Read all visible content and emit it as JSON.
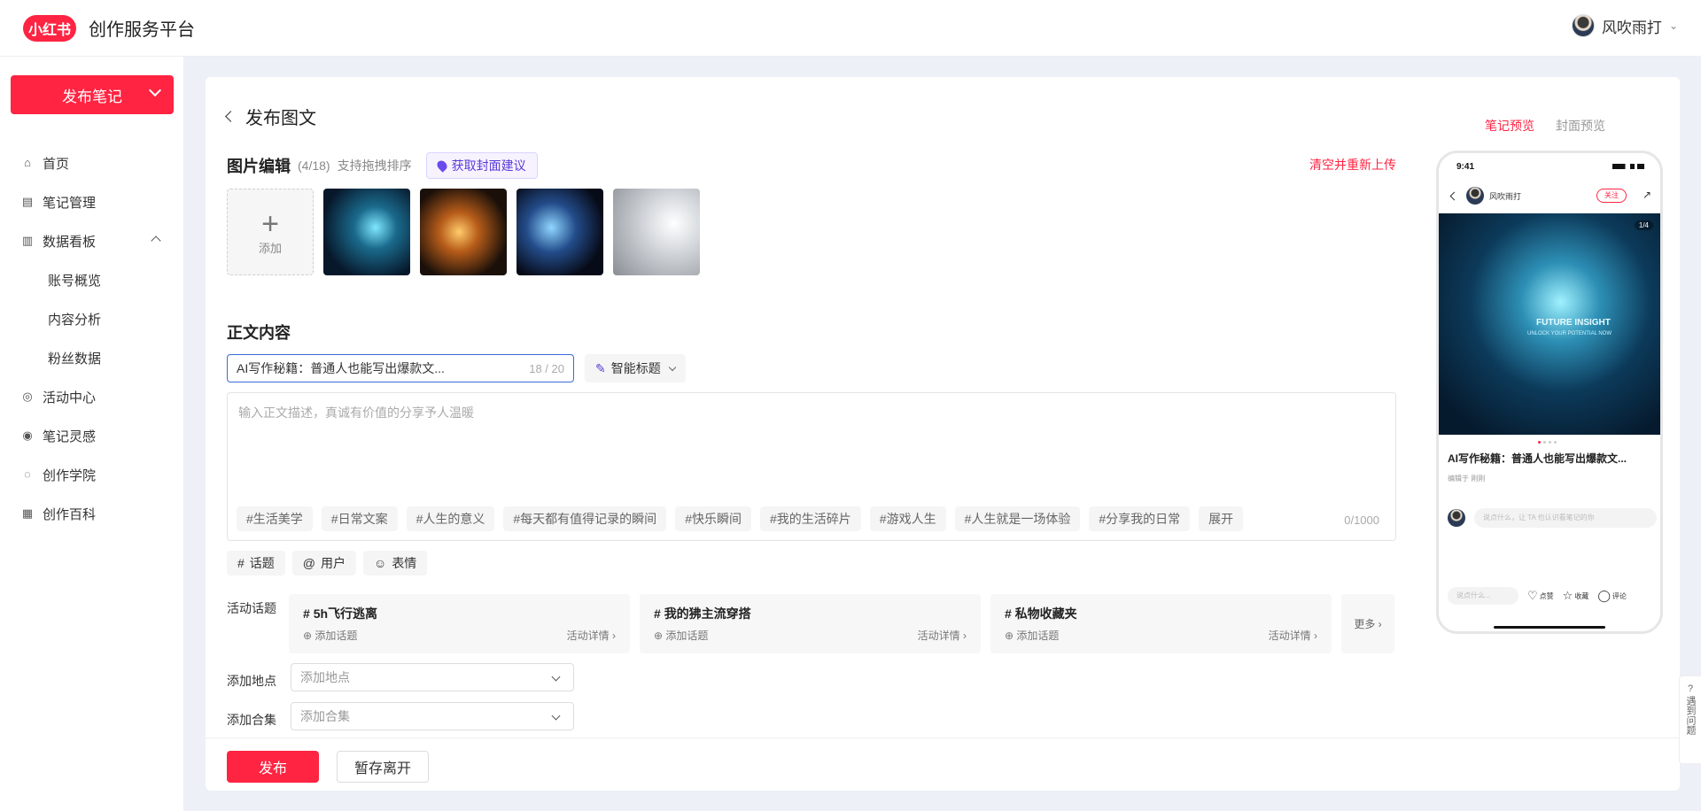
{
  "header": {
    "logo": "小红书",
    "platform": "创作服务平台",
    "username": "风吹雨打"
  },
  "sidebar": {
    "publish_label": "发布笔记",
    "items": [
      {
        "label": "首页",
        "icon": "home-icon"
      },
      {
        "label": "笔记管理",
        "icon": "note-icon"
      },
      {
        "label": "数据看板",
        "icon": "chart-icon"
      },
      {
        "label": "账号概览"
      },
      {
        "label": "内容分析"
      },
      {
        "label": "粉丝数据"
      },
      {
        "label": "活动中心",
        "icon": "activity-icon"
      },
      {
        "label": "笔记灵感",
        "icon": "inspiration-icon"
      },
      {
        "label": "创作学院",
        "icon": "academy-icon"
      },
      {
        "label": "创作百科",
        "icon": "wiki-icon"
      }
    ]
  },
  "editor": {
    "page_title": "发布图文",
    "image_section": "图片编辑",
    "image_count": "(4/18)",
    "image_hint": "支持拖拽排序",
    "cover_suggest": "获取封面建议",
    "reset_upload": "清空并重新上传",
    "add_label": "添加",
    "body_section": "正文内容",
    "title_value": "AI写作秘籍：普通人也能写出爆款文...",
    "title_counter": "18 / 20",
    "smart_title": "智能标题",
    "desc_placeholder": "输入正文描述，真诚有价值的分享予人温暖",
    "tags": [
      "#生活美学",
      "#日常文案",
      "#人生的意义",
      "#每天都有值得记录的瞬间",
      "#快乐瞬间",
      "#我的生活碎片",
      "#游戏人生",
      "#人生就是一场体验",
      "#分享我的日常"
    ],
    "expand": "展开",
    "desc_counter": "0/1000",
    "tools": [
      "话题",
      "用户",
      "表情"
    ],
    "activity_label": "活动话题",
    "activities": [
      {
        "name": "5h飞行逃离",
        "add": "添加话题",
        "detail": "活动详情"
      },
      {
        "name": "我的狒主流穿搭",
        "add": "添加话题",
        "detail": "活动详情"
      },
      {
        "name": "私物收藏夹",
        "add": "添加话题",
        "detail": "活动详情"
      }
    ],
    "more": "更多",
    "location_label": "添加地点",
    "location_placeholder": "添加地点",
    "collection_label": "添加合集",
    "collection_placeholder": "添加合集",
    "publish": "发布",
    "save_exit": "暂存离开"
  },
  "preview": {
    "tab_note": "笔记预览",
    "tab_cover": "封面预览",
    "time": "9:41",
    "username": "风吹雨打",
    "follow": "关注",
    "page": "1/4",
    "img_text": "FUTURE INSIGHT",
    "img_sub": "UNLOCK YOUR POTENTIAL NOW",
    "title": "AI写作秘籍：普通人也能写出爆款文...",
    "edit": "编辑于 刚刚",
    "comment_placeholder": "说点什么，让 TA 也认识看笔记的你",
    "say": "说点什么...",
    "like": "点赞",
    "collect": "收藏",
    "comment": "评论"
  },
  "help": {
    "label": "遇到问题"
  }
}
